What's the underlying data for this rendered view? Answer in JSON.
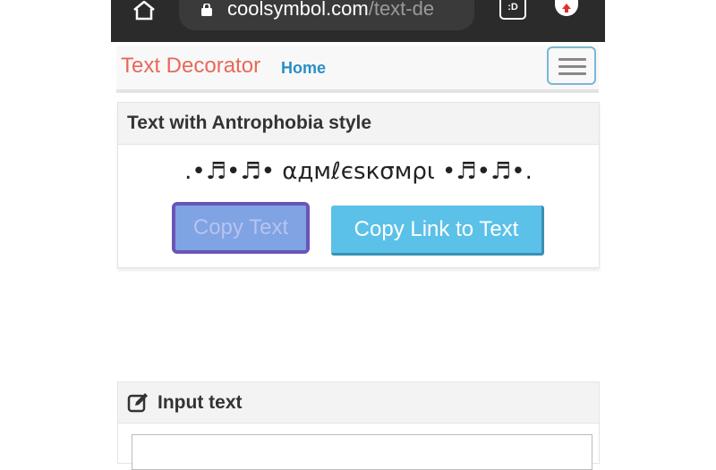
{
  "browser": {
    "url_main": "coolsymbol.com",
    "url_path": "/text-de",
    "tabs_label": ":D"
  },
  "navbar": {
    "brand": "Text Decorator",
    "home": "Home"
  },
  "style_panel": {
    "title": "Text with Antrophobia style",
    "styled_text": ".•♬•♬• αдмℓєѕкσмρι •♬•♬•.",
    "copy_button": "Copy Text",
    "copy_link_button": "Copy Link to Text"
  },
  "input_panel": {
    "title": "Input text"
  },
  "colors": {
    "brand": "#e8685a",
    "home_link": "#2a8fc4",
    "copy_button": "#7fa3e3",
    "copy_button_border": "#6a55b8",
    "copy_link_button": "#5bc1e8",
    "browser_bar": "#2b2b2b"
  },
  "icons": {
    "home": "home-icon",
    "lock": "lock-icon",
    "update": "arrow-up-icon",
    "menu": "hamburger-icon",
    "edit": "edit-icon"
  }
}
